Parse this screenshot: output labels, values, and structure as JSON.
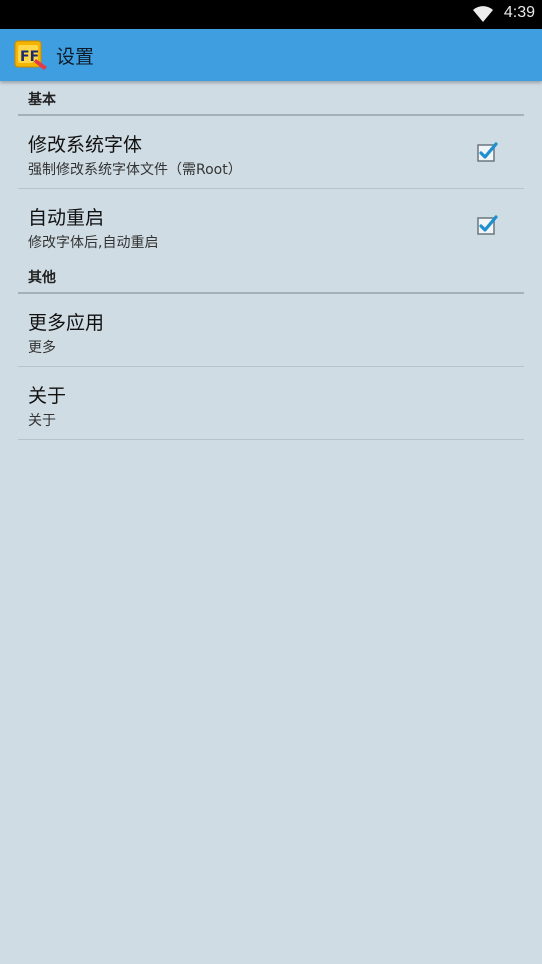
{
  "status_bar": {
    "time": "4:39",
    "wifi_icon": "wifi-icon"
  },
  "action_bar": {
    "title": "设置",
    "app_icon": "app-logo-icon"
  },
  "sections": [
    {
      "header": "基本",
      "items": [
        {
          "title": "修改系统字体",
          "summary": "强制修改系统字体文件（需Root）",
          "checked": true
        },
        {
          "title": "自动重启",
          "summary": "修改字体后,自动重启",
          "checked": true
        }
      ]
    },
    {
      "header": "其他",
      "items": [
        {
          "title": "更多应用",
          "summary": "更多"
        },
        {
          "title": "关于",
          "summary": "关于"
        }
      ]
    }
  ],
  "colors": {
    "action_bar": "#3f9ee0",
    "background": "#cfdce3",
    "checkmark": "#1e8fd0"
  }
}
